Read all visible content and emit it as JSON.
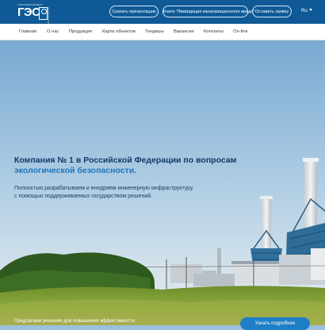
{
  "header": {
    "logo_small_text": "ГАЗОХИМКОМПЛЕКТ",
    "logo_main_text": "ГЭС",
    "logo_side_text": "ИНЖИНИРИНГ",
    "buttons": [
      {
        "label": "Скачать презентацию"
      },
      {
        "label": "Книга \"Ликвидация канализационного вреда\""
      },
      {
        "label": "Оставить заявку"
      }
    ],
    "language": "Ru"
  },
  "nav": {
    "items": [
      {
        "label": "Главная"
      },
      {
        "label": "О нас"
      },
      {
        "label": "Продукция"
      },
      {
        "label": "Карта объектов"
      },
      {
        "label": "Тендеры"
      },
      {
        "label": "Вакансии"
      },
      {
        "label": "Контакты"
      },
      {
        "label": "On-line"
      }
    ]
  },
  "hero": {
    "headline_line1": "Компания № 1 в Российской Федерации по вопросам",
    "headline_line2": "экологической безопасности.",
    "subtext_line1": "Полностью разрабатываем и внедряем инженерную инфраструктуру",
    "subtext_line2": "с помощью поддерживаемых государством решений.",
    "bottom_text": "Предлагаем решения для повышения эффективности",
    "more_button": "Узнать подробнее"
  },
  "colors": {
    "topbar": "#0f5a96",
    "accent": "#1b76c1",
    "headline": "#123a66"
  }
}
